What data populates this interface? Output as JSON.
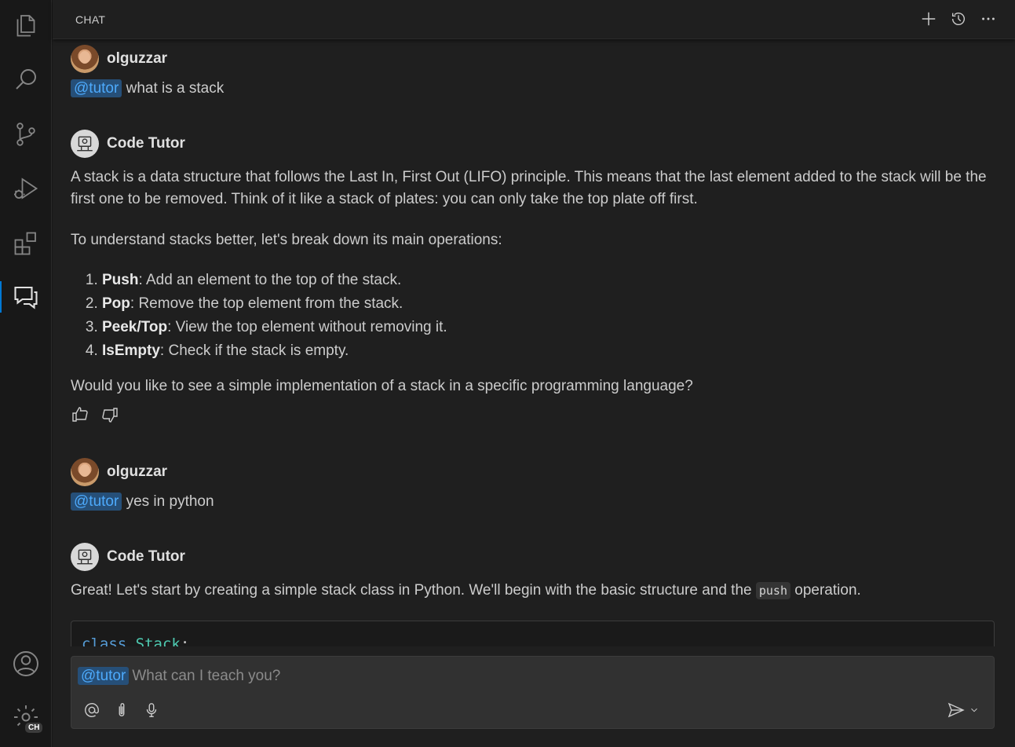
{
  "activity_bar": {
    "items": [
      "explorer-icon",
      "search-icon",
      "source-control-icon",
      "run-debug-icon",
      "extensions-icon",
      "chat-icon"
    ],
    "active": "chat-icon",
    "accounts_icon": "accounts-icon",
    "settings_icon": "settings-gear-icon",
    "settings_badge": "CH"
  },
  "chat": {
    "title": "CHAT",
    "header_actions": [
      "new-chat-icon",
      "history-icon",
      "more-actions-icon"
    ],
    "messages": [
      {
        "author": "olguzzar",
        "mention": "@tutor",
        "text": " what is a stack"
      },
      {
        "author": "Code Tutor",
        "paragraphs": [
          "A stack is a data structure that follows the Last In, First Out (LIFO) principle. This means that the last element added to the stack will be the first one to be removed. Think of it like a stack of plates: you can only take the top plate off first.",
          "To understand stacks better, let's break down its main operations:"
        ],
        "list": [
          {
            "term": "Push",
            "desc": ": Add an element to the top of the stack."
          },
          {
            "term": "Pop",
            "desc": ": Remove the top element from the stack."
          },
          {
            "term": "Peek/Top",
            "desc": ": View the top element without removing it."
          },
          {
            "term": "IsEmpty",
            "desc": ": Check if the stack is empty."
          }
        ],
        "closing": "Would you like to see a simple implementation of a stack in a specific programming language?"
      },
      {
        "author": "olguzzar",
        "mention": "@tutor",
        "text": " yes in python"
      },
      {
        "author": "Code Tutor",
        "text_before": "Great! Let's start by creating a simple stack class in Python. We'll begin with the basic structure and the ",
        "code": "push",
        "text_after": " operation.",
        "code_block": {
          "keyword": "class",
          "class_name": "Stack",
          "punct": ":"
        }
      }
    ],
    "input": {
      "mention": "@tutor",
      "placeholder": "What can I teach you?",
      "tools": [
        "at-icon",
        "attach-icon",
        "mic-icon"
      ],
      "send_icon": "send-icon"
    }
  },
  "colors": {
    "accent": "#0078d4",
    "mention_bg": "#264f78",
    "mention_fg": "#4daafc",
    "panel_bg": "#1f1f1f"
  }
}
